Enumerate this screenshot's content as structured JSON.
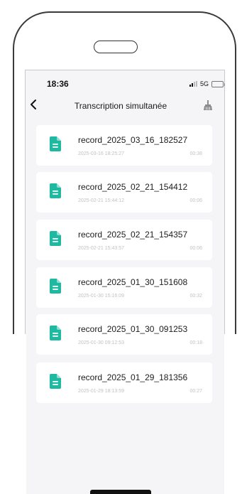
{
  "status_bar": {
    "time": "18:36",
    "network": "5G"
  },
  "header": {
    "title": "Transcription simultanée"
  },
  "colors": {
    "accent": "#1fb8a0",
    "background": "#f5f5f7"
  },
  "recordings": [
    {
      "name": "record_2025_03_16_182527",
      "date": "2025-03-16 18:25:27",
      "duration": "00:38"
    },
    {
      "name": "record_2025_02_21_154412",
      "date": "2025-02-21 15:44:12",
      "duration": "00:06"
    },
    {
      "name": "record_2025_02_21_154357",
      "date": "2025-02-21 15:43:57",
      "duration": "00:06"
    },
    {
      "name": "record_2025_01_30_151608",
      "date": "2025-01-30 15:16:09",
      "duration": "00:32"
    },
    {
      "name": "record_2025_01_30_091253",
      "date": "2025-01-30 09:12:53",
      "duration": "00:18"
    },
    {
      "name": "record_2025_01_29_181356",
      "date": "2025-01-29 18:13:59",
      "duration": "00:27"
    }
  ]
}
